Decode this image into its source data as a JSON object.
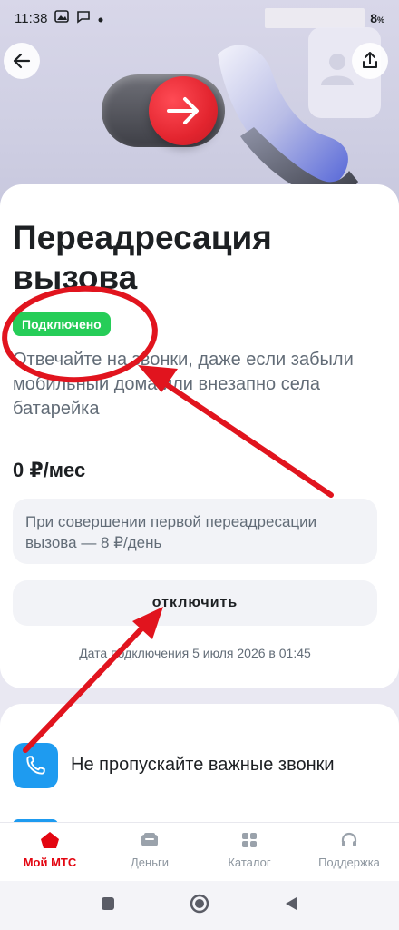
{
  "status_bar": {
    "time": "11:38",
    "battery": "8"
  },
  "page": {
    "title": "Переадресация вызова",
    "badge": "Подключено",
    "description": "Отвечайте на звонки, даже если забыли мобильный дома или внезапно села батарейка",
    "price": "0 ₽/мес",
    "note": "При совершении первой переадресации вызова — 8 ₽/день",
    "disable_label": "отключить",
    "connect_date": "Дата подключения 5 июля 2026 в 01:45"
  },
  "feature": {
    "text": "Не пропускайте важные звонки",
    "icon": "phone-icon"
  },
  "bottom_nav": [
    {
      "label": "Мой МТС",
      "icon": "home-icon",
      "active": true
    },
    {
      "label": "Деньги",
      "icon": "wallet-icon",
      "active": false
    },
    {
      "label": "Каталог",
      "icon": "grid-icon",
      "active": false
    },
    {
      "label": "Поддержка",
      "icon": "headset-icon",
      "active": false
    }
  ],
  "colors": {
    "brand_red": "#e30611",
    "badge_green": "#26cd58",
    "feature_blue": "#1e9bf0",
    "annotation_red": "#e1141e"
  }
}
